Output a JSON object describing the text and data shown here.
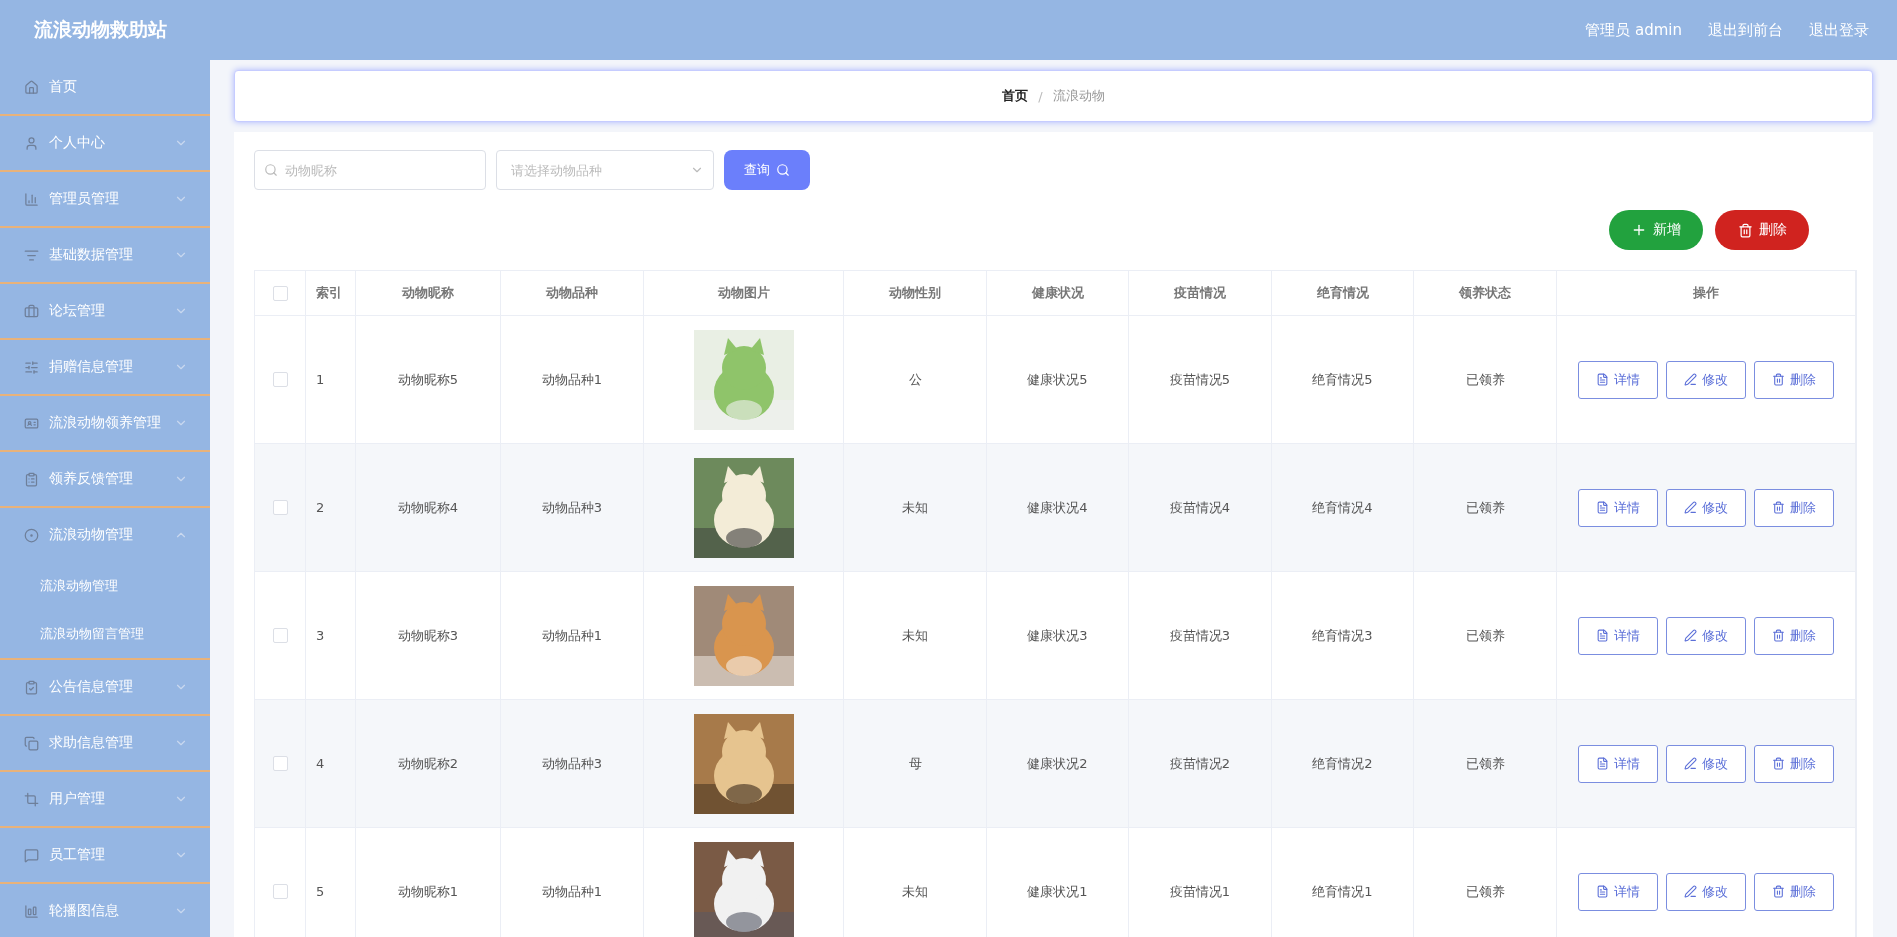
{
  "header": {
    "title": "流浪动物救助站",
    "links": [
      "管理员 admin",
      "退出到前台",
      "退出登录"
    ]
  },
  "sidebar": {
    "items": [
      {
        "label": "首页",
        "kind": "link"
      },
      {
        "label": "个人中心",
        "kind": "menu",
        "expanded": false
      },
      {
        "label": "管理员管理",
        "kind": "menu",
        "expanded": false
      },
      {
        "label": "基础数据管理",
        "kind": "menu",
        "expanded": false
      },
      {
        "label": "论坛管理",
        "kind": "menu",
        "expanded": false
      },
      {
        "label": "捐赠信息管理",
        "kind": "menu",
        "expanded": false
      },
      {
        "label": "流浪动物领养管理",
        "kind": "menu",
        "expanded": false
      },
      {
        "label": "领养反馈管理",
        "kind": "menu",
        "expanded": false
      },
      {
        "label": "流浪动物管理",
        "kind": "menu",
        "expanded": true,
        "children": [
          {
            "label": "流浪动物管理"
          },
          {
            "label": "流浪动物留言管理"
          }
        ]
      },
      {
        "label": "公告信息管理",
        "kind": "menu",
        "expanded": false
      },
      {
        "label": "求助信息管理",
        "kind": "menu",
        "expanded": false
      },
      {
        "label": "用户管理",
        "kind": "menu",
        "expanded": false
      },
      {
        "label": "员工管理",
        "kind": "menu",
        "expanded": false
      },
      {
        "label": "轮播图信息",
        "kind": "menu",
        "expanded": false
      }
    ]
  },
  "breadcrumb": {
    "home": "首页",
    "separator": "/",
    "current": "流浪动物"
  },
  "search": {
    "name_placeholder": "动物昵称",
    "breed_placeholder": "请选择动物品种",
    "button": "查询"
  },
  "actions": [
    "新增",
    "删除"
  ],
  "table": {
    "columns": [
      "索引",
      "动物昵称",
      "动物品种",
      "动物图片",
      "动物性别",
      "健康状况",
      "疫苗情况",
      "绝育情况",
      "领养状态",
      "操作"
    ],
    "all_checked": false,
    "rows": [
      {
        "checked": false,
        "cells": [
          "1",
          "动物昵称5",
          "动物品种1",
          "",
          "公",
          "健康状况5",
          "疫苗情况5",
          "绝育情况5",
          "已领养"
        ],
        "image": {
          "kind": "picture"
        },
        "buttons": [
          "详情",
          "修改",
          "删除"
        ]
      },
      {
        "checked": false,
        "cells": [
          "2",
          "动物昵称4",
          "动物品种3",
          "",
          "未知",
          "健康状况4",
          "疫苗情况4",
          "绝育情况4",
          "已领养"
        ],
        "image": {
          "kind": "picture"
        },
        "buttons": [
          "详情",
          "修改",
          "删除"
        ]
      },
      {
        "checked": false,
        "cells": [
          "3",
          "动物昵称3",
          "动物品种1",
          "",
          "未知",
          "健康状况3",
          "疫苗情况3",
          "绝育情况3",
          "已领养"
        ],
        "image": {
          "kind": "picture"
        },
        "buttons": [
          "详情",
          "修改",
          "删除"
        ]
      },
      {
        "checked": false,
        "cells": [
          "4",
          "动物昵称2",
          "动物品种3",
          "",
          "母",
          "健康状况2",
          "疫苗情况2",
          "绝育情况2",
          "已领养"
        ],
        "image": {
          "kind": "picture"
        },
        "buttons": [
          "详情",
          "修改",
          "删除"
        ]
      },
      {
        "checked": false,
        "cells": [
          "5",
          "动物昵称1",
          "动物品种1",
          "",
          "未知",
          "健康状况1",
          "疫苗情况1",
          "绝育情况1",
          "已领养"
        ],
        "image": {
          "kind": "picture"
        },
        "buttons": [
          "详情",
          "修改",
          "删除"
        ]
      }
    ]
  }
}
